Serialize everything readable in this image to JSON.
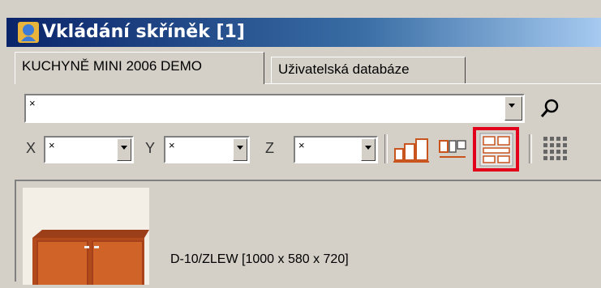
{
  "window": {
    "title": "Vkládání skříněk [1]"
  },
  "tabs": [
    {
      "label": "KUCHYNĚ MINI 2006 DEMO",
      "active": true
    },
    {
      "label": "Uživatelská databáze",
      "active": false
    }
  ],
  "search": {
    "value": "×"
  },
  "filters": {
    "x": {
      "label": "X",
      "value": "×"
    },
    "y": {
      "label": "Y",
      "value": "×"
    },
    "z": {
      "label": "Z",
      "value": "×"
    }
  },
  "toolbar": {
    "view_buttons": [
      "view-small-icons",
      "view-medium-icons",
      "view-large-icons"
    ],
    "highlighted": "view-large-icons",
    "highlight_color": "#e3001b"
  },
  "items": [
    {
      "label": "D-10/ZLEW  [1000 x 580 x 720]"
    }
  ],
  "colors": {
    "titlebar_start": "#0a246a",
    "titlebar_end": "#a6caf0",
    "cabinet": "#c8541e"
  }
}
